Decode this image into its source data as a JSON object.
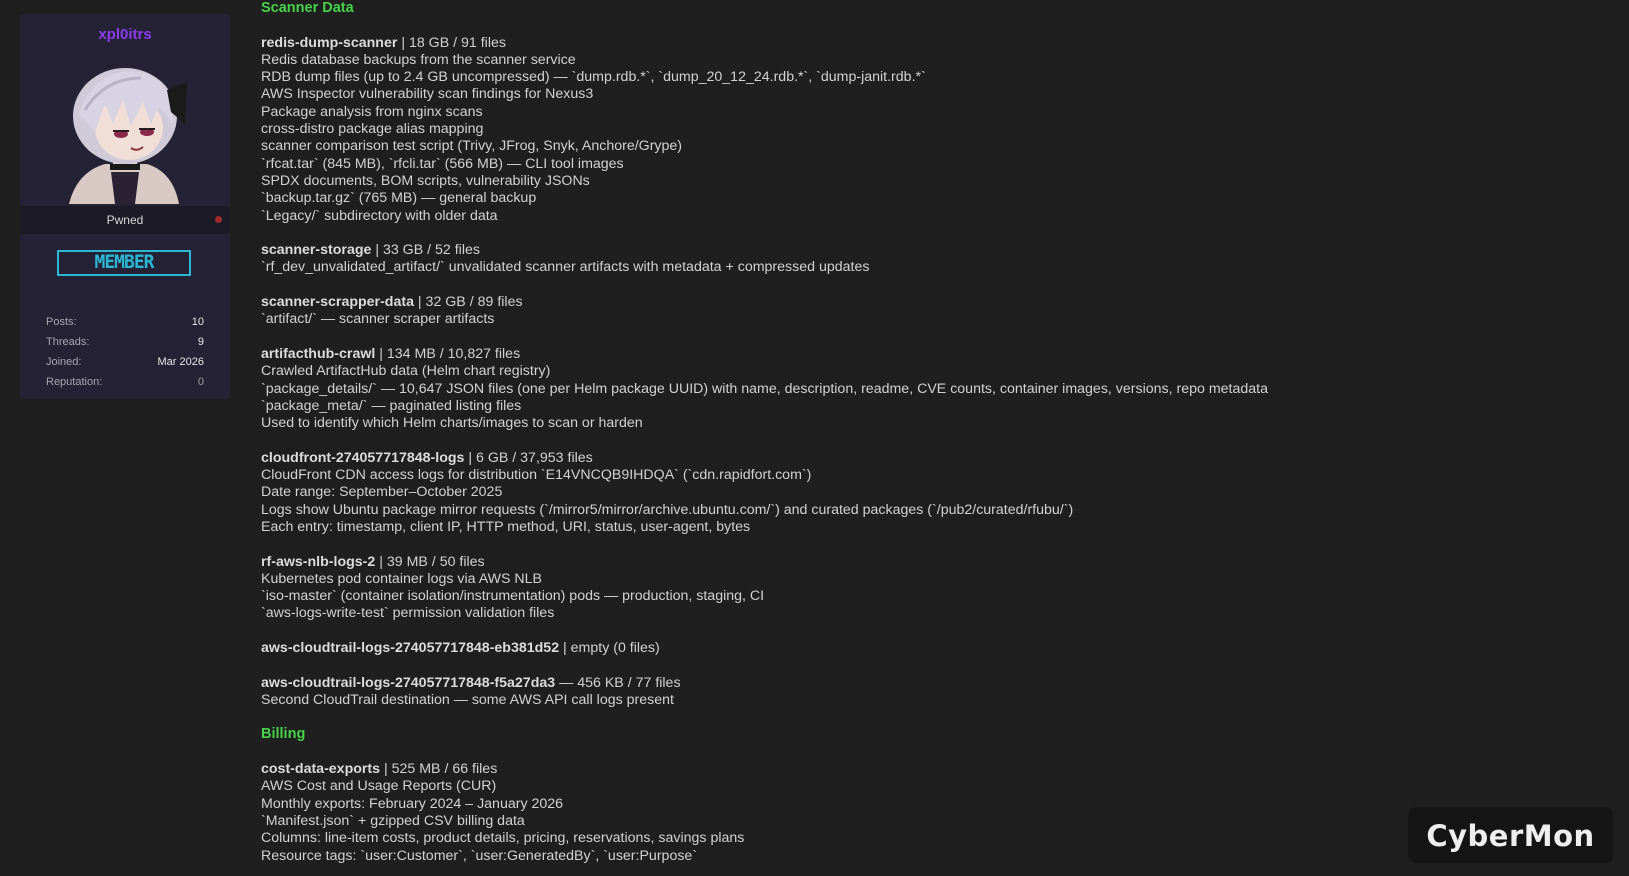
{
  "profile": {
    "username": "xpl0itrs",
    "status_label": "Pwned",
    "rank": "MEMBER",
    "stats": [
      {
        "label": "Posts:",
        "value": "10"
      },
      {
        "label": "Threads:",
        "value": "9"
      },
      {
        "label": "Joined:",
        "value": "Mar 2026"
      },
      {
        "label": "Reputation:",
        "value": "0"
      }
    ],
    "colors": {
      "username": "#8a3cf0",
      "rank": "#2ab7d3",
      "status_dot": "#a12a2a"
    }
  },
  "post": {
    "sections": [
      {
        "heading": "Scanner Data",
        "blocks": [
          {
            "name": "redis-dump-scanner",
            "meta": " | 18 GB / 91 files",
            "lines": [
              "Redis database backups from the scanner service",
              "RDB dump files (up to 2.4 GB uncompressed) — `dump.rdb.*`, `dump_20_12_24.rdb.*`, `dump-janit.rdb.*`",
              "AWS Inspector vulnerability scan findings for Nexus3",
              "Package analysis from nginx scans",
              "cross-distro package alias mapping",
              "scanner comparison test script (Trivy, JFrog, Snyk, Anchore/Grype)",
              "`rfcat.tar` (845 MB), `rfcli.tar` (566 MB) — CLI tool images",
              "SPDX documents, BOM scripts, vulnerability JSONs",
              "`backup.tar.gz` (765 MB) — general backup",
              "`Legacy/` subdirectory with older data"
            ]
          },
          {
            "name": "scanner-storage",
            "meta": " | 33 GB / 52 files",
            "lines": [
              "`rf_dev_unvalidated_artifact/`  unvalidated scanner artifacts with metadata + compressed updates"
            ]
          },
          {
            "name": "scanner-scrapper-data",
            "meta": " | 32 GB / 89 files",
            "lines": [
              "`artifact/` — scanner scraper artifacts"
            ]
          },
          {
            "name": "artifacthub-crawl",
            "meta": " | 134 MB / 10,827 files",
            "lines": [
              "Crawled ArtifactHub data (Helm chart registry)",
              "`package_details/` — 10,647 JSON files (one per Helm package UUID) with name, description, readme, CVE counts, container images, versions, repo metadata",
              "`package_meta/` — paginated listing files",
              "Used to identify which Helm charts/images to scan or harden"
            ]
          },
          {
            "name": "cloudfront-274057717848-logs",
            "meta": " | 6 GB / 37,953 files",
            "lines": [
              "CloudFront CDN access logs for distribution `E14VNCQB9IHDQA` (`cdn.rapidfort.com`)",
              "Date range: September–October 2025",
              "Logs show Ubuntu package mirror requests (`/mirror5/mirror/archive.ubuntu.com/`) and curated packages (`/pub2/curated/rfubu/`)",
              "Each entry: timestamp, client IP, HTTP method, URI, status, user-agent, bytes"
            ]
          },
          {
            "name": "rf-aws-nlb-logs-2",
            "meta": " | 39 MB / 50 files",
            "lines": [
              "Kubernetes pod container logs via AWS NLB",
              "`iso-master` (container isolation/instrumentation) pods — production, staging, CI",
              "`aws-logs-write-test` permission validation files"
            ]
          },
          {
            "name": "aws-cloudtrail-logs-274057717848-eb381d52",
            "meta": " | empty (0 files)",
            "lines": []
          },
          {
            "name": "aws-cloudtrail-logs-274057717848-f5a27da3",
            "meta": " — 456 KB / 77 files",
            "lines": [
              "Second CloudTrail destination — some AWS API call logs present"
            ]
          }
        ]
      },
      {
        "heading": "Billing",
        "blocks": [
          {
            "name": "cost-data-exports",
            "meta": " | 525 MB / 66 files",
            "lines": [
              "AWS Cost and Usage Reports (CUR)",
              "Monthly exports: February 2024 – January 2026",
              "`Manifest.json` + gzipped CSV billing data",
              "Columns: line-item costs, product details, pricing, reservations, savings plans",
              "Resource tags: `user:Customer`, `user:GeneratedBy`, `user:Purpose`"
            ]
          }
        ]
      }
    ],
    "colors": {
      "heading": "#46d24a"
    }
  },
  "watermark": {
    "text": "CyberMon"
  }
}
